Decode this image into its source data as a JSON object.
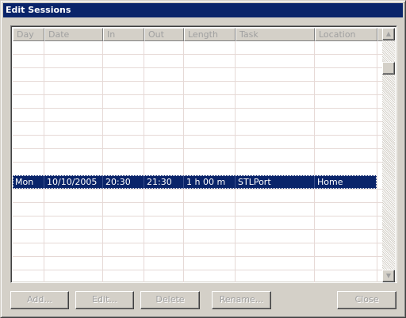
{
  "window": {
    "title": "Edit Sessions"
  },
  "table": {
    "columns": [
      "Day",
      "Date",
      "In",
      "Out",
      "Length",
      "Task",
      "Location"
    ],
    "rows": [
      {
        "day": "Mon",
        "date": "10/10/2005",
        "in": "20:30",
        "out": "21:30",
        "length": "1 h 00 m",
        "task": "STLPort",
        "location": "Home",
        "selected": true
      }
    ]
  },
  "scrollbar": {
    "up_icon": "▲",
    "down_icon": "▼"
  },
  "buttons": {
    "add": "Add...",
    "edit": "Edit...",
    "delete": "Delete",
    "rename": "Rename...",
    "close": "Close"
  },
  "colors": {
    "titlebar": "#0a246a",
    "selection": "#0a246a",
    "face": "#d4d0c8"
  }
}
